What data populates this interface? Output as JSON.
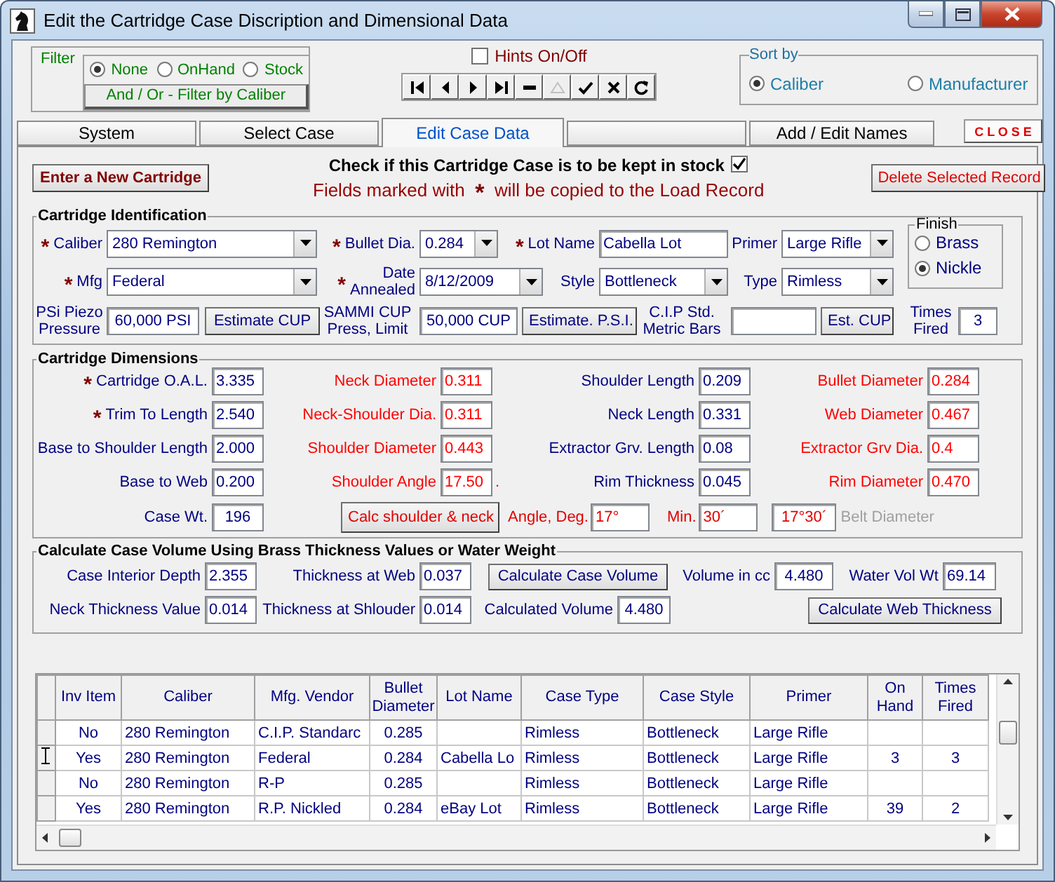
{
  "window": {
    "title": "Edit the Cartridge Case Discription and Dimensional Data"
  },
  "filter": {
    "title": "Filter",
    "options": [
      {
        "label": "None",
        "selected": true
      },
      {
        "label": "OnHand",
        "selected": false
      },
      {
        "label": "Stock",
        "selected": false
      }
    ],
    "button": "And / Or - Filter by Caliber"
  },
  "hints": {
    "label": "Hints On/Off",
    "checked": false
  },
  "navigator": [
    {
      "kind": "first",
      "disabled": false
    },
    {
      "kind": "previous",
      "disabled": false
    },
    {
      "kind": "next",
      "disabled": false
    },
    {
      "kind": "last",
      "disabled": false
    },
    {
      "kind": "delete",
      "disabled": false
    },
    {
      "kind": "edit",
      "disabled": true
    },
    {
      "kind": "post",
      "disabled": false
    },
    {
      "kind": "cancel",
      "disabled": false
    },
    {
      "kind": "refresh",
      "disabled": false
    }
  ],
  "sort": {
    "title": "Sort by",
    "options": [
      {
        "label": "Caliber",
        "selected": true
      },
      {
        "label": "Manufacturer",
        "selected": false
      }
    ]
  },
  "tabs": [
    {
      "label": "System",
      "selected": false
    },
    {
      "label": "Select Case",
      "selected": false
    },
    {
      "label": "Edit Case Data",
      "selected": true
    },
    {
      "selected": false
    },
    {
      "label": "Add / Edit Names",
      "selected": false
    }
  ],
  "close_button": "C L O S E",
  "stock": {
    "label": "Check if this Cartridge Case is to be kept in stock",
    "checked": true
  },
  "new_button": "Enter a New Cartridge",
  "notice": {
    "before": "Fields marked with",
    "mark": "*",
    "after": "will be copied to the Load Record"
  },
  "delete_button": "Delete Selected Record",
  "identification": {
    "title": "Cartridge Identification",
    "caliber": {
      "mark": "*",
      "label": "Caliber",
      "value": "280 Remington"
    },
    "bullet_dia": {
      "mark": "*",
      "label": "Bullet Dia.",
      "value": "0.284"
    },
    "lot_name": {
      "mark": "*",
      "label": "Lot Name",
      "value": "Cabella Lot"
    },
    "primer": {
      "label": "Primer",
      "value": "Large Rifle"
    },
    "mfg": {
      "mark": "*",
      "label": "Mfg",
      "value": "Federal"
    },
    "date_annealed": {
      "mark": "*",
      "label": "Date\nAnnealed",
      "value": "8/12/2009"
    },
    "style": {
      "label": "Style",
      "value": "Bottleneck"
    },
    "type": {
      "label": "Type",
      "value": "Rimless"
    },
    "finish": {
      "title": "Finish",
      "options": [
        {
          "label": "Brass",
          "selected": false
        },
        {
          "label": "Nickle",
          "selected": true
        }
      ]
    },
    "psi_piezo": {
      "label": "PSi Piezo\nPressure",
      "value": "60,000 PSI"
    },
    "estimate_cup_button": "Estimate CUP",
    "sammi_cup": {
      "label": "SAMMI CUP\nPress, Limit",
      "value": "50,000 CUP"
    },
    "estimate_psi_button": "Estimate. P.S.I.",
    "cip_std": {
      "label": "C.I.P Std.\nMetric Bars"
    },
    "est_cup_button": "Est. CUP",
    "times_fired": {
      "label": "Times\nFired",
      "value": "3"
    }
  },
  "dimensions": {
    "title": "Cartridge Dimensions",
    "fields": [
      {
        "mark": "*",
        "label": "Cartridge O.A.L.",
        "value": "3.335",
        "color": "#000080"
      },
      {
        "label": "Neck Diameter",
        "value": "0.311",
        "color": "#ff0000"
      },
      {
        "label": "Shoulder Length",
        "value": "0.209",
        "color": "#000080"
      },
      {
        "label": "Bullet Diameter",
        "value": "0.284",
        "color": "#ff0000"
      },
      {
        "mark": "*",
        "label": "Trim To Length",
        "value": "2.540",
        "color": "#000080"
      },
      {
        "label": "Neck-Shoulder Dia.",
        "value": "0.311",
        "color": "#ff0000"
      },
      {
        "label": "Neck Length",
        "value": "0.331",
        "color": "#000080"
      },
      {
        "label": "Web Diameter",
        "value": "0.467",
        "color": "#ff0000"
      },
      {
        "label": "Base to Shoulder Length",
        "value": "2.000",
        "color": "#000080"
      },
      {
        "label": "Shoulder Diameter",
        "value": "0.443",
        "color": "#ff0000"
      },
      {
        "label": "Extractor Grv. Length",
        "value": "0.08",
        "color": "#000080"
      },
      {
        "label": "Extractor Grv Dia.",
        "value": "0.4",
        "color": "#ff0000"
      },
      {
        "label": "Base to Web",
        "value": "0.200",
        "color": "#000080"
      },
      {
        "label": "Shoulder Angle",
        "value": "17.50",
        "suffix": ".",
        "color": "#ff0000"
      },
      {
        "label": "Rim Thickness",
        "value": "0.045",
        "color": "#000080"
      },
      {
        "label": "Rim Diameter",
        "value": "0.470",
        "color": "#ff0000"
      }
    ],
    "case_weight": {
      "label": "Case Wt.",
      "value": "196"
    },
    "calc_button": "Calc shoulder & neck",
    "angle": {
      "label": "Angle, Deg.",
      "value": "17°"
    },
    "minutes": {
      "label": "Min.",
      "value": "30´"
    },
    "combined": {
      "value": "17°30´"
    },
    "belt_diameter": {
      "label": "Belt Diameter",
      "disabled": true
    }
  },
  "volume": {
    "title": "Calculate Case Volume Using Brass Thickness Values or Water Weight",
    "interior_depth": {
      "label": "Case Interior Depth",
      "value": "2.355"
    },
    "thickness_web": {
      "label": "Thickness at Web",
      "value": "0.037"
    },
    "calc_volume_button": "Calculate Case Volume",
    "volume_cc": {
      "label": "Volume in cc",
      "value": "4.480"
    },
    "water_vol": {
      "label": "Water Vol Wt",
      "value": "69.14"
    },
    "neck_thickness": {
      "label": "Neck Thickness Value",
      "value": "0.014"
    },
    "thickness_shoulder": {
      "label": "Thickness at Shlouder",
      "value": "0.014"
    },
    "calculated_volume": {
      "label": "Calculated Volume",
      "value": "4.480"
    },
    "calc_web_button": "Calculate Web Thickness"
  },
  "table": {
    "columns": [
      "Inv Item",
      "Caliber",
      "Mfg. Vendor",
      "Bullet Diameter",
      "Lot Name",
      "Case Type",
      "Case Style",
      "Primer",
      "On Hand",
      "Times Fired"
    ],
    "rows": [
      {
        "selected": false,
        "cells": [
          "No",
          "280 Remington",
          "C.I.P. Standarc",
          "0.285",
          null,
          "Rimless",
          "Bottleneck",
          "Large Rifle",
          null,
          null
        ]
      },
      {
        "selected": true,
        "cells": [
          "Yes",
          "280 Remington",
          "Federal",
          "0.284",
          "Cabella Lo",
          "Rimless",
          "Bottleneck",
          "Large Rifle",
          "3",
          "3"
        ]
      },
      {
        "selected": false,
        "cells": [
          "No",
          "280 Remington",
          "R-P",
          "0.285",
          null,
          "Rimless",
          "Bottleneck",
          "Large Rifle",
          null,
          null
        ]
      },
      {
        "selected": false,
        "cells": [
          "Yes",
          "280 Remington",
          "R.P. Nickled",
          "0.284",
          "eBay Lot",
          "Rimless",
          "Bottleneck",
          "Large Rifle",
          "39",
          "2"
        ]
      }
    ]
  }
}
